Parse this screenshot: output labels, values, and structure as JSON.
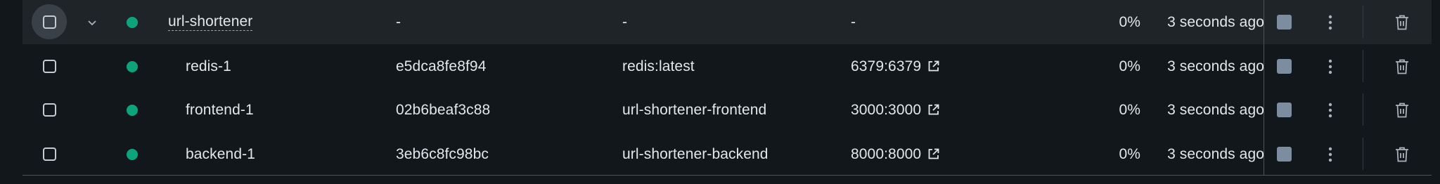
{
  "colors": {
    "status_running": "#0ea47b",
    "group_row_bg": "#1f2429",
    "page_bg": "#12171c",
    "stop_button": "#7b8d9e"
  },
  "group": {
    "name": "url-shortener",
    "container_id": "-",
    "image": "-",
    "ports": "-",
    "cpu": "0%",
    "started": "3 seconds ago",
    "status": "running"
  },
  "containers": [
    {
      "name": "redis-1",
      "container_id": "e5dca8fe8f94",
      "image": "redis:latest",
      "ports": "6379:6379",
      "cpu": "0%",
      "started": "3 seconds ago",
      "status": "running"
    },
    {
      "name": "frontend-1",
      "container_id": "02b6beaf3c88",
      "image": "url-shortener-frontend",
      "ports": "3000:3000",
      "cpu": "0%",
      "started": "3 seconds ago",
      "status": "running"
    },
    {
      "name": "backend-1",
      "container_id": "3eb6c8fc98bc",
      "image": "url-shortener-backend",
      "ports": "8000:8000",
      "cpu": "0%",
      "started": "3 seconds ago",
      "status": "running"
    }
  ],
  "icons": {
    "expand": "chevron-down-icon",
    "external": "external-link-icon",
    "actions": "more-vertical-icon",
    "delete": "trash-icon",
    "stop": "stop-icon"
  }
}
